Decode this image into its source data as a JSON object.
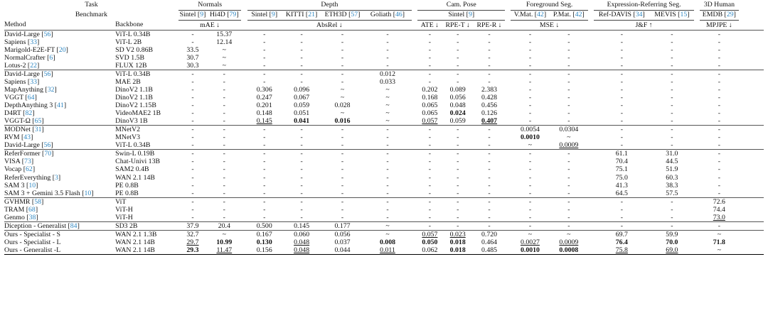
{
  "header": {
    "task_label": "Task",
    "benchmark_label": "Benchmark",
    "method_label": "Method",
    "backbone_label": "Backbone",
    "groups": [
      "Normals",
      "Depth",
      "Cam. Pose",
      "Foreground Seg.",
      "Expression-Referring Seg.",
      "3D Human"
    ],
    "benchmarks": [
      {
        "name": "Sintel",
        "ref": "9"
      },
      {
        "name": "Hi4D",
        "ref": "79"
      },
      {
        "name": "Sintel",
        "ref": "9"
      },
      {
        "name": "KITTI",
        "ref": "21"
      },
      {
        "name": "ETH3D",
        "ref": "57"
      },
      {
        "name": "Goliath",
        "ref": "46"
      },
      {
        "name": "Sintel",
        "ref": "9"
      },
      {
        "name": "V.Mat.",
        "ref": "42"
      },
      {
        "name": "P.Mat.",
        "ref": "42"
      },
      {
        "name": "Ref-DAVIS",
        "ref": "34"
      },
      {
        "name": "MEVIS",
        "ref": "15"
      },
      {
        "name": "EMDB",
        "ref": "29"
      }
    ],
    "metrics": [
      "mAE ↓",
      "AbsRel ↓",
      "ATE ↓",
      "RPE-T ↓",
      "RPE-R ↓",
      "MSE ↓",
      "J&F ↑",
      "MPJPE ↓"
    ]
  },
  "sections": [
    [
      {
        "method": "David-Large",
        "ref": "56",
        "backbone": "ViT-L 0.34B",
        "cells": [
          "-",
          "15.37",
          "-",
          "-",
          "-",
          "-",
          "-",
          "-",
          "-",
          "-",
          "-",
          "-",
          "-",
          "-"
        ]
      },
      {
        "method": "Sapiens",
        "ref": "33",
        "backbone": "ViT-L 2B",
        "cells": [
          "-",
          "12.14",
          "-",
          "-",
          "-",
          "-",
          "-",
          "-",
          "-",
          "-",
          "-",
          "-",
          "-",
          "-"
        ]
      },
      {
        "method": "Marigold-E2E-FT",
        "ref": "20",
        "backbone": "SD V2 0.86B",
        "cells": [
          "33.5",
          "~",
          "-",
          "-",
          "-",
          "-",
          "-",
          "-",
          "-",
          "-",
          "-",
          "-",
          "-",
          "-"
        ]
      },
      {
        "method": "NormalCrafter",
        "ref": "6",
        "backbone": "SVD 1.5B",
        "cells": [
          "30.7",
          "~",
          "-",
          "-",
          "-",
          "-",
          "-",
          "-",
          "-",
          "-",
          "-",
          "-",
          "-",
          "-"
        ]
      },
      {
        "method": "Lotus-2",
        "ref": "22",
        "backbone": "FLUX 12B",
        "cells": [
          "30.3",
          "~",
          "-",
          "-",
          "-",
          "-",
          "-",
          "-",
          "-",
          "-",
          "-",
          "-",
          "-",
          "-"
        ]
      }
    ],
    [
      {
        "method": "David-Large",
        "ref": "56",
        "backbone": "ViT-L 0.34B",
        "cells": [
          "-",
          "-",
          "-",
          "-",
          "-",
          "0.012",
          "-",
          "-",
          "-",
          "-",
          "-",
          "-",
          "-",
          "-"
        ]
      },
      {
        "method": "Sapiens",
        "ref": "33",
        "backbone": "MAE 2B",
        "cells": [
          "-",
          "-",
          "-",
          "-",
          "-",
          "0.033",
          "-",
          "-",
          "-",
          "-",
          "-",
          "-",
          "-",
          "-"
        ]
      },
      {
        "method": "MapAnything",
        "ref": "32",
        "backbone": "DinoV2 1.1B",
        "cells": [
          "-",
          "-",
          "0.306",
          "0.096",
          "~",
          "~",
          "0.202",
          "0.089",
          "2.383",
          "-",
          "-",
          "-",
          "-",
          "-"
        ]
      },
      {
        "method": "VGGT",
        "ref": "64",
        "backbone": "DinoV2 1.1B",
        "cells": [
          "-",
          "-",
          "0.247",
          "0.067",
          "~",
          "~",
          "0.168",
          "0.056",
          "0.428",
          "-",
          "-",
          "-",
          "-",
          "-"
        ]
      },
      {
        "method": "DepthAnything 3",
        "ref": "41",
        "backbone": "DinoV2 1.15B",
        "cells": [
          "-",
          "-",
          "0.201",
          "0.059",
          "0.028",
          "~",
          "0.065",
          "0.048",
          "0.456",
          "-",
          "-",
          "-",
          "-",
          "-"
        ]
      },
      {
        "method": "D4RT",
        "ref": "82",
        "backbone": "VideoMAE2 1B",
        "cells": [
          "-",
          "-",
          "0.148",
          "0.051",
          "~",
          "~",
          "0.065",
          "0.024",
          "0.126",
          "-",
          "-",
          "-",
          "-",
          "-"
        ]
      },
      {
        "method": "VGGT-Ω",
        "ref": "65",
        "backbone": "DinoV3 1B",
        "cells": [
          "-",
          "-",
          "0.145",
          "0.041",
          "0.016",
          "~",
          "0.057",
          "0.059",
          "0.407",
          "-",
          "-",
          "-",
          "-",
          "-"
        ]
      }
    ],
    [
      {
        "method": "MODNet",
        "ref": "31",
        "backbone": "MNetV2",
        "cells": [
          "-",
          "-",
          "-",
          "-",
          "-",
          "-",
          "-",
          "-",
          "-",
          "0.0054",
          "0.0304",
          "-",
          "-",
          "-"
        ]
      },
      {
        "method": "RVM",
        "ref": "43",
        "backbone": "MNetV3",
        "cells": [
          "-",
          "-",
          "-",
          "-",
          "-",
          "-",
          "-",
          "-",
          "-",
          "0.0010",
          "~",
          "-",
          "-",
          "-"
        ]
      },
      {
        "method": "David-Large",
        "ref": "56",
        "backbone": "ViT-L 0.34B",
        "cells": [
          "-",
          "-",
          "-",
          "-",
          "-",
          "-",
          "-",
          "-",
          "-",
          "~",
          "0.0009",
          "-",
          "-",
          "-"
        ]
      }
    ],
    [
      {
        "method": "ReferFormer",
        "ref": "70",
        "backbone": "Swin-L 0.19B",
        "cells": [
          "-",
          "-",
          "-",
          "-",
          "-",
          "-",
          "-",
          "-",
          "-",
          "-",
          "-",
          "61.1",
          "31.0",
          "-"
        ]
      },
      {
        "method": "VISA",
        "ref": "73",
        "backbone": "Chat-Univi 13B",
        "cells": [
          "-",
          "-",
          "-",
          "-",
          "-",
          "-",
          "-",
          "-",
          "-",
          "-",
          "-",
          "70.4",
          "44.5",
          "-"
        ]
      },
      {
        "method": "Vocap",
        "ref": "62",
        "backbone": "SAM2 0.4B",
        "cells": [
          "-",
          "-",
          "-",
          "-",
          "-",
          "-",
          "-",
          "-",
          "-",
          "-",
          "-",
          "75.1",
          "51.9",
          "-"
        ]
      },
      {
        "method": "ReferEverything",
        "ref": "3",
        "backbone": "WAN 2.1 14B",
        "cells": [
          "-",
          "-",
          "-",
          "-",
          "-",
          "-",
          "-",
          "-",
          "-",
          "-",
          "-",
          "75.0",
          "60.3",
          "-"
        ]
      },
      {
        "method": "SAM 3",
        "ref": "10",
        "backbone": "PE 0.8B",
        "cells": [
          "-",
          "-",
          "-",
          "-",
          "-",
          "-",
          "-",
          "-",
          "-",
          "-",
          "-",
          "41.3",
          "38.3",
          "-"
        ]
      },
      {
        "method": "SAM 3 + Gemini 3.5 Flash",
        "ref": "10",
        "backbone": "PE 0.8B",
        "cells": [
          "-",
          "-",
          "-",
          "-",
          "-",
          "-",
          "-",
          "-",
          "-",
          "-",
          "-",
          "64.5",
          "57.5",
          "-"
        ]
      }
    ],
    [
      {
        "method": "GVHMR",
        "ref": "58",
        "backbone": "ViT",
        "cells": [
          "-",
          "-",
          "-",
          "-",
          "-",
          "-",
          "-",
          "-",
          "-",
          "-",
          "-",
          "-",
          "-",
          "72.6"
        ]
      },
      {
        "method": "TRAM",
        "ref": "68",
        "backbone": "ViT-H",
        "cells": [
          "-",
          "-",
          "-",
          "-",
          "-",
          "-",
          "-",
          "-",
          "-",
          "-",
          "-",
          "-",
          "-",
          "74.4"
        ]
      },
      {
        "method": "Genmo",
        "ref": "38",
        "backbone": "ViT-H",
        "cells": [
          "-",
          "-",
          "-",
          "-",
          "-",
          "-",
          "-",
          "-",
          "-",
          "-",
          "-",
          "-",
          "-",
          "73.0"
        ]
      }
    ],
    [
      {
        "method": "Diception - Generalist",
        "ref": "84",
        "backbone": "SD3 2B",
        "cells": [
          "37.9",
          "20.4",
          "0.500",
          "0.145",
          "0.177",
          "~",
          "-",
          "-",
          "-",
          "-",
          "-",
          "-",
          "-",
          "-"
        ]
      }
    ],
    [
      {
        "method": "Ours - Specialist - S",
        "ref": "",
        "backbone": "WAN 2.1 1.3B",
        "cells": [
          "32.7",
          "~",
          "0.167",
          "0.060",
          "0.056",
          "~",
          "0.057",
          "0.023",
          "0.720",
          "~",
          "~",
          "69.7",
          "59.9",
          "~"
        ]
      },
      {
        "method": "Ours - Specialist - L",
        "ref": "",
        "backbone": "WAN 2.1 14B",
        "cells": [
          "29.7",
          "10.99",
          "0.130",
          "0.048",
          "0.037",
          "0.008",
          "0.050",
          "0.018",
          "0.464",
          "0.0027",
          "0.0009",
          "76.4",
          "70.0",
          "71.8"
        ]
      },
      {
        "method": "Ours - Generalist -L",
        "ref": "",
        "backbone": "WAN 2.1 14B",
        "cells": [
          "29.3",
          "11.47",
          "0.156",
          "0.048",
          "0.044",
          "0.011",
          "0.062",
          "0.018",
          "0.485",
          "0.0010",
          "0.0008",
          "75.8",
          "69.0",
          "~"
        ]
      }
    ]
  ]
}
